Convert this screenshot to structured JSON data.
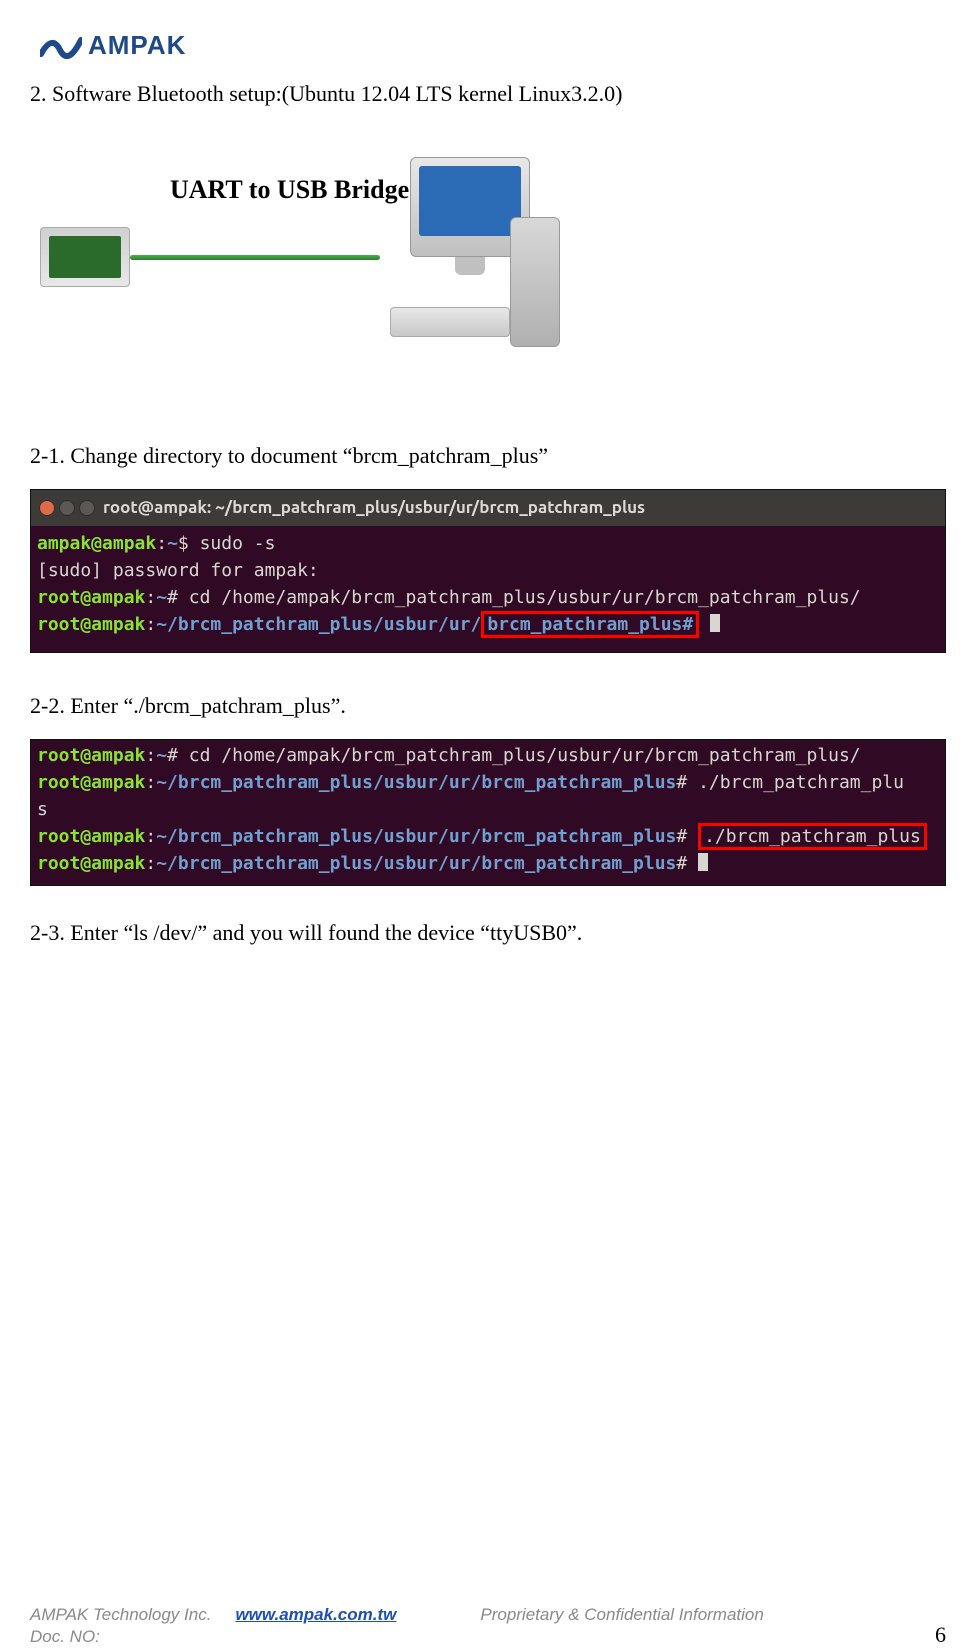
{
  "logo": {
    "text": "AMPAK"
  },
  "steps": {
    "s2": "2.   Software Bluetooth    setup:(Ubuntu 12.04 LTS kernel Linux3.2.0)",
    "s2_1": "2-1. Change directory to document    “brcm_patchram_plus”",
    "s2_2": "2-2. Enter    “./brcm_patchram_plus”.",
    "s2_3": "2-3. Enter    “ls /dev/” and you will found the device “ttyUSB0”."
  },
  "figure": {
    "bridge_label": "UART to USB Bridge"
  },
  "term1": {
    "title": "root@ampak: ~/brcm_patchram_plus/usbur/ur/brcm_patchram_plus",
    "l1_user": "ampak@ampak",
    "l1_path": "~",
    "l1_sym": "$",
    "l1_cmd": "sudo -s",
    "l2": "[sudo] password for ampak:",
    "l3_user": "root@ampak",
    "l3_path": "~",
    "l3_sym": "#",
    "l3_cmd": "cd /home/ampak/brcm_patchram_plus/usbur/ur/brcm_patchram_plus/",
    "l4_user": "root@ampak",
    "l4_path_pre": "~/brcm_patchram_plus/usbur/ur/",
    "l4_box": "brcm_patchram_plus#"
  },
  "term2": {
    "l1_user": "root@ampak",
    "l1_path": "~",
    "l1_sym": "#",
    "l1_cmd": "cd /home/ampak/brcm_patchram_plus/usbur/ur/brcm_patchram_plus/",
    "l2_user": "root@ampak",
    "l2_path": "~/brcm_patchram_plus/usbur/ur/brcm_patchram_plus",
    "l2_sym": "#",
    "l2_cmd": "./brcm_patchram_plu",
    "l2_wrap": "s",
    "l3_user": "root@ampak",
    "l3_path": "~/brcm_patchram_plus/usbur/ur/brcm_patchram_plus",
    "l3_sym": "#",
    "l3_box": "./brcm_patchram_plus",
    "l4_user": "root@ampak",
    "l4_path": "~/brcm_patchram_plus/usbur/ur/brcm_patchram_plus",
    "l4_sym": "#"
  },
  "footer": {
    "company": "AMPAK Technology Inc.",
    "url": "www.ampak.com.tw",
    "conf": "Proprietary & Confidential Information",
    "doc": "Doc. NO:",
    "page": "6"
  }
}
